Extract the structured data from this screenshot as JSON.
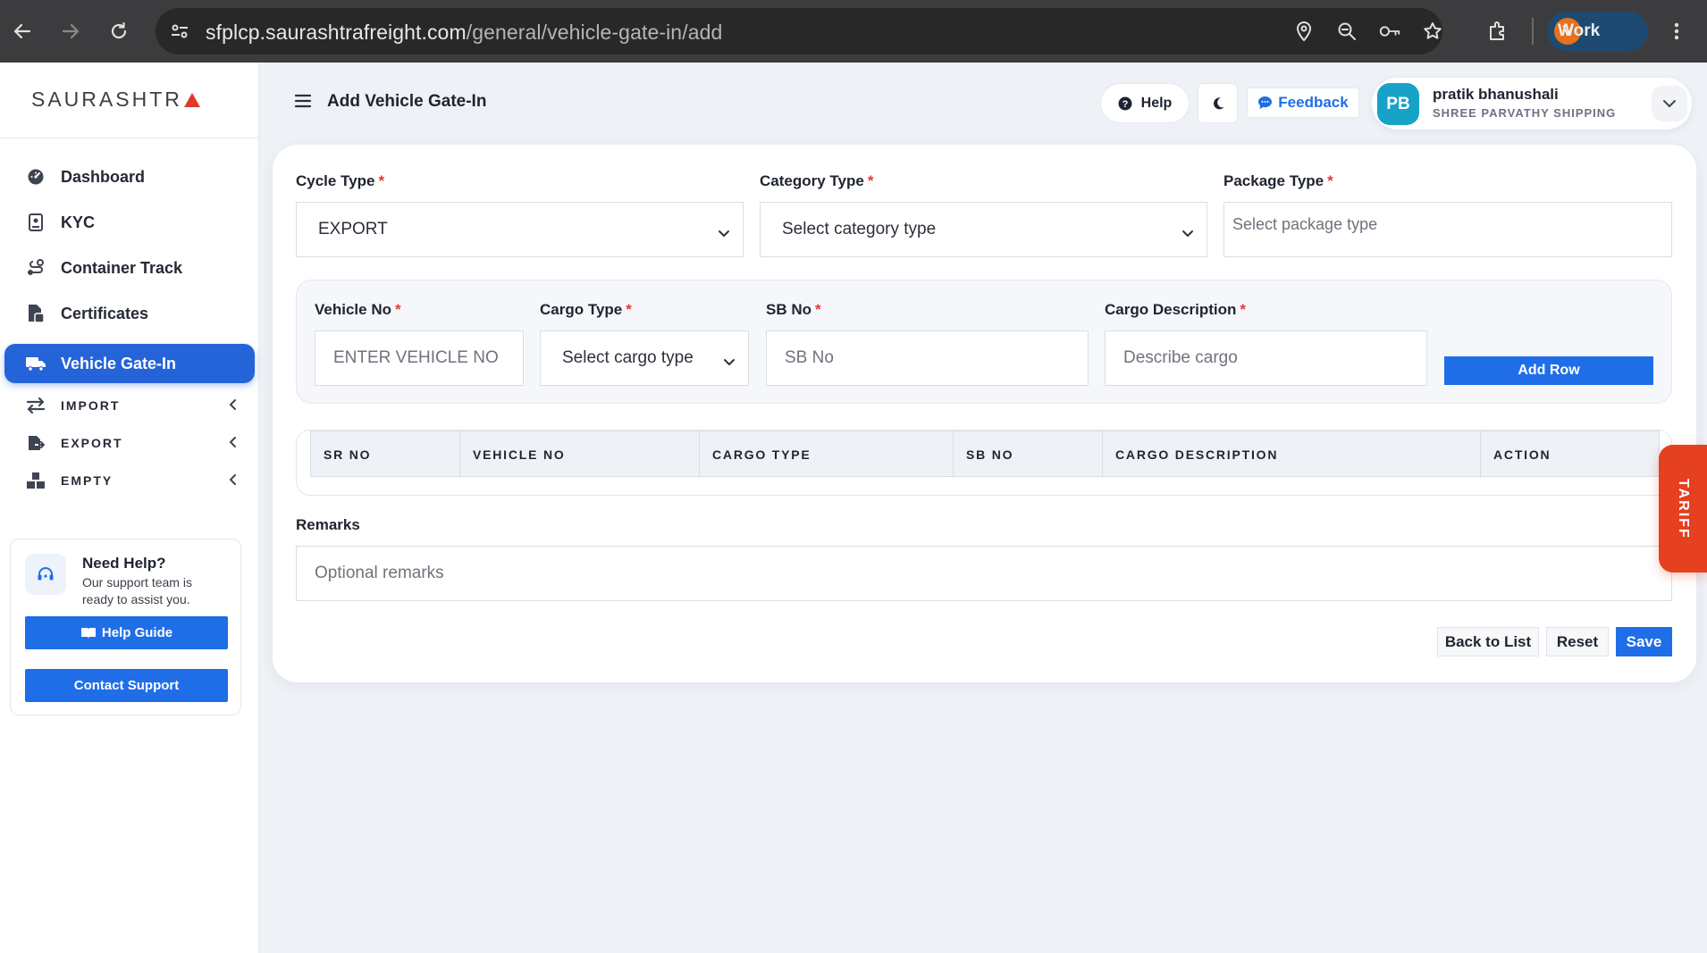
{
  "browser": {
    "url_host": "sfplcp.saurashtrafreight.com",
    "url_path": "/general/vehicle-gate-in/add",
    "profile_initial": "V",
    "profile_label": "Work"
  },
  "sidebar": {
    "logo": "SAURASHTR",
    "items": [
      {
        "label": "Dashboard",
        "icon": "dashboard-icon"
      },
      {
        "label": "KYC",
        "icon": "id-card-icon"
      },
      {
        "label": "Container Track",
        "icon": "route-icon"
      },
      {
        "label": "Certificates",
        "icon": "file-icon"
      },
      {
        "label": "Vehicle Gate-In",
        "icon": "truck-icon",
        "active": true
      },
      {
        "label": "IMPORT",
        "icon": "exchange-icon"
      },
      {
        "label": "EXPORT",
        "icon": "export-icon"
      },
      {
        "label": "EMPTY",
        "icon": "boxes-icon"
      }
    ],
    "help": {
      "title": "Need Help?",
      "subtitle": "Our support team is ready to assist you.",
      "guide_label": "Help Guide",
      "contact_label": "Contact Support"
    }
  },
  "header": {
    "title": "Add Vehicle Gate-In",
    "help_label": "Help",
    "feedback_label": "Feedback",
    "user": {
      "initials": "PB",
      "name": "pratik bhanushali",
      "org": "SHREE PARVATHY SHIPPING"
    }
  },
  "form": {
    "cycle_type": {
      "label": "Cycle Type",
      "value": "EXPORT"
    },
    "category_type": {
      "label": "Category Type",
      "placeholder": "Select category type"
    },
    "package_type": {
      "label": "Package Type",
      "placeholder": "Select package type"
    },
    "vehicle_no": {
      "label": "Vehicle No",
      "placeholder": "ENTER VEHICLE NO"
    },
    "cargo_type": {
      "label": "Cargo Type",
      "placeholder": "Select cargo type"
    },
    "sb_no": {
      "label": "SB No",
      "placeholder": "SB No"
    },
    "cargo_description": {
      "label": "Cargo Description",
      "placeholder": "Describe cargo"
    },
    "add_row_label": "Add Row",
    "required_mark": "*",
    "table_headers": [
      "SR NO",
      "VEHICLE NO",
      "CARGO TYPE",
      "SB NO",
      "CARGO DESCRIPTION",
      "ACTION"
    ],
    "remarks": {
      "label": "Remarks",
      "placeholder": "Optional remarks"
    },
    "actions": {
      "back": "Back to List",
      "reset": "Reset",
      "save": "Save"
    }
  },
  "tariff_label": "TARIFF",
  "colors": {
    "primary": "#1f6ee8",
    "active_nav": "#2563d9",
    "tariff": "#e5401f",
    "required": "#e53935"
  }
}
